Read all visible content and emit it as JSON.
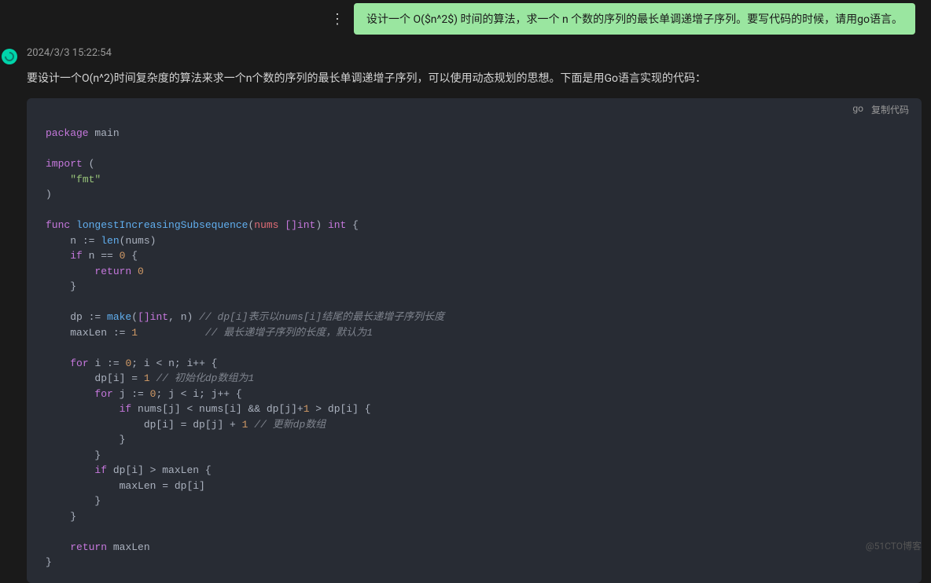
{
  "user_message": "设计一个 O($n^2$) 时间的算法，求一个 n 个数的序列的最长单调递增子序列。要写代码的时候，请用go语言。",
  "timestamp": "2024/3/3 15:22:54",
  "description": "要设计一个O(n^2)时间复杂度的算法来求一个n个数的序列的最长单调递增子序列，可以使用动态规划的思想。下面是用Go语言实现的代码：",
  "code": {
    "lang": "go",
    "copy_label": "复制代码",
    "tokens": {
      "package": "package",
      "main": "main",
      "import": "import",
      "fmt": "\"fmt\"",
      "func": "func",
      "fn_name": "longestIncreasingSubsequence",
      "nums": "nums",
      "int_arr": "[]int",
      "int": "int",
      "n_assign": "n := ",
      "len": "len",
      "if": "if",
      "n_eq_0": "n == ",
      "zero": "0",
      "return": "return",
      "dp_assign": "dp := ",
      "make": "make",
      "n_var": "n",
      "cmt1": "// dp[i]表示以nums[i]结尾的最长递增子序列长度",
      "maxlen_assign": "maxLen := ",
      "one": "1",
      "cmt2": "// 最长递增子序列的长度，默认为1",
      "for": "for",
      "i_init": "i := ",
      "i_cond": "; i < n; i++ {",
      "dp_i_1": "dp[i] = ",
      "cmt3": "// 初始化dp数组为1",
      "j_init": "j := ",
      "j_cond": "; j < i; j++ {",
      "if_cond": "nums[j] < nums[i] && dp[j]+",
      "gt_dpi": " > dp[i] {",
      "dp_update": "dp[i] = dp[j] + ",
      "cmt4": "// 更新dp数组",
      "if_dpi_gt": "dp[i] > maxLen {",
      "maxlen_update": "maxLen = dp[i]",
      "return_maxlen": "maxLen"
    }
  },
  "watermark": "@51CTO博客"
}
